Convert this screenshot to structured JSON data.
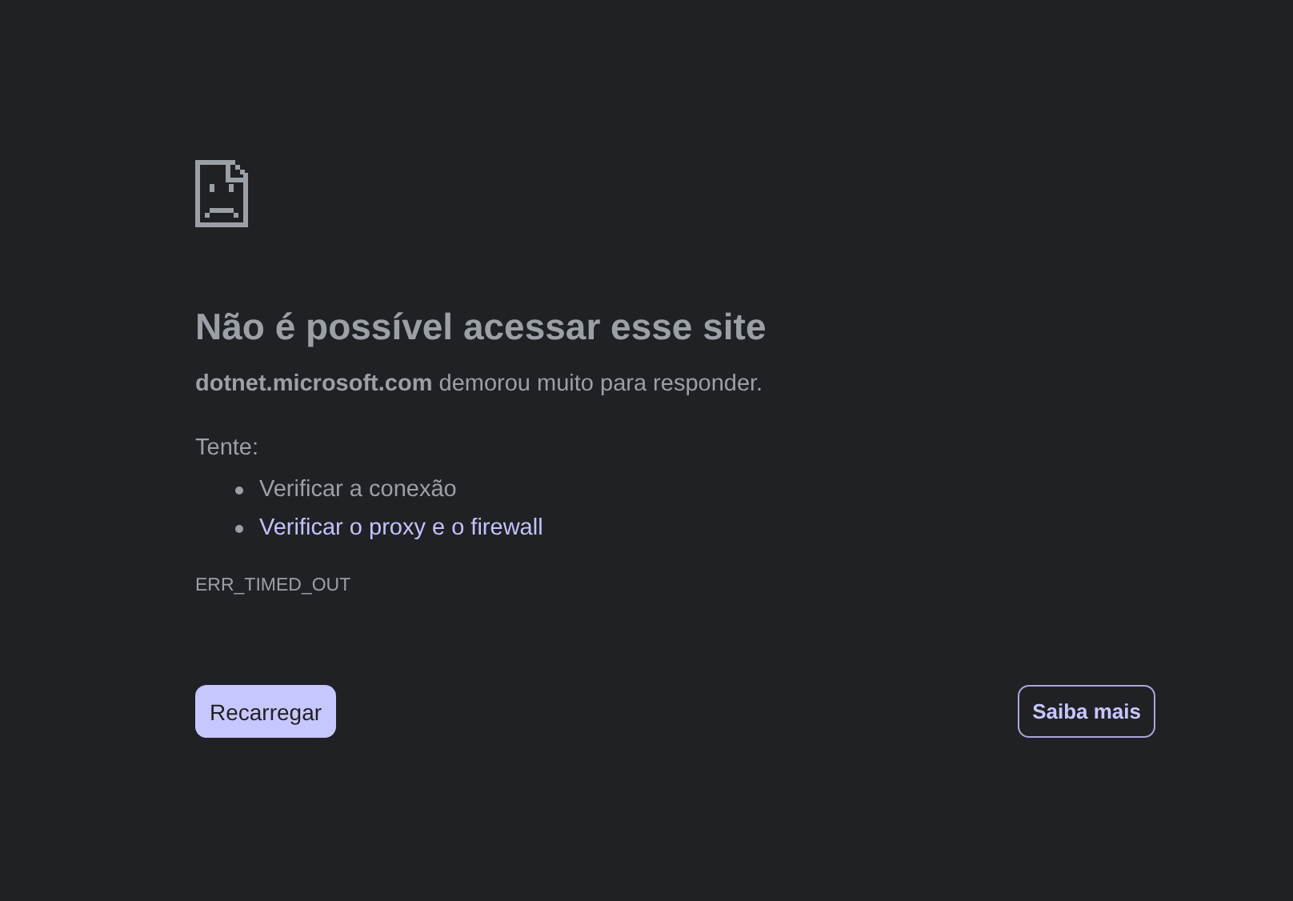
{
  "error_page": {
    "title": "Não é possível acessar esse site",
    "message": "**dotnet.microsoft.com** demorou muito para responder.",
    "suggestions_heading": "Tente:",
    "suggestions": [
      {
        "kind": "text",
        "text": "Verificar a conexão"
      },
      {
        "kind": "link",
        "text": "Verificar o proxy e o firewall"
      }
    ],
    "error_code": "ERR_TIMED_OUT",
    "buttons": [
      {
        "kind": "primary",
        "label": "Recarregar"
      },
      {
        "kind": "outline",
        "label": "Saiba mais"
      }
    ]
  }
}
